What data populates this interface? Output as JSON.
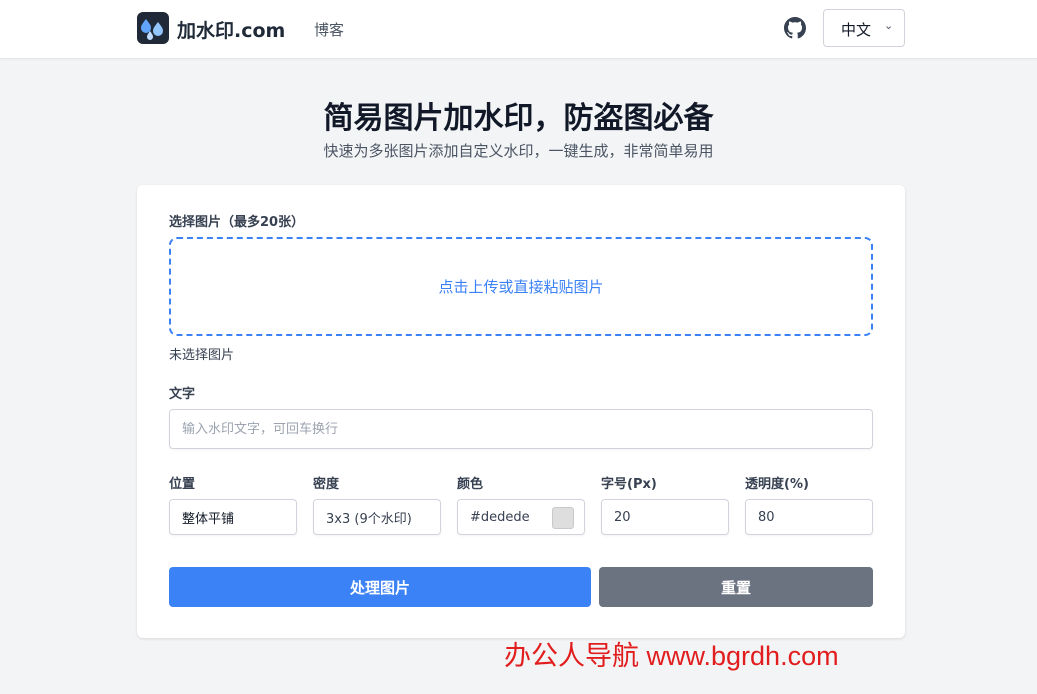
{
  "header": {
    "brand": "加水印.com",
    "nav_blog": "博客",
    "language": "中文",
    "logo_icon": "water-drops-icon",
    "github_icon": "github-icon"
  },
  "hero": {
    "title": "简易图片加水印，防盗图必备",
    "subtitle": "快速为多张图片添加自定义水印，一键生成，非常简单易用"
  },
  "form": {
    "select_label": "选择图片（最多20张）",
    "dropzone_text": "点击上传或直接粘贴图片",
    "no_file_text": "未选择图片",
    "text_label": "文字",
    "text_placeholder": "输入水印文字，可回车换行",
    "position_label": "位置",
    "position_value": "整体平铺",
    "density_label": "密度",
    "density_value": "3x3 (9个水印)",
    "color_label": "颜色",
    "color_value": "#dedede",
    "font_size_label": "字号(Px)",
    "font_size_value": "20",
    "opacity_label": "透明度(%)",
    "opacity_value": "80",
    "process_button": "处理图片",
    "reset_button": "重置"
  },
  "overlay_watermark": "办公人导航  www.bgrdh.com",
  "colors": {
    "primary": "#3b82f6",
    "secondary": "#6b7280",
    "swatch": "#dedede",
    "watermark": "#e11d1d"
  }
}
